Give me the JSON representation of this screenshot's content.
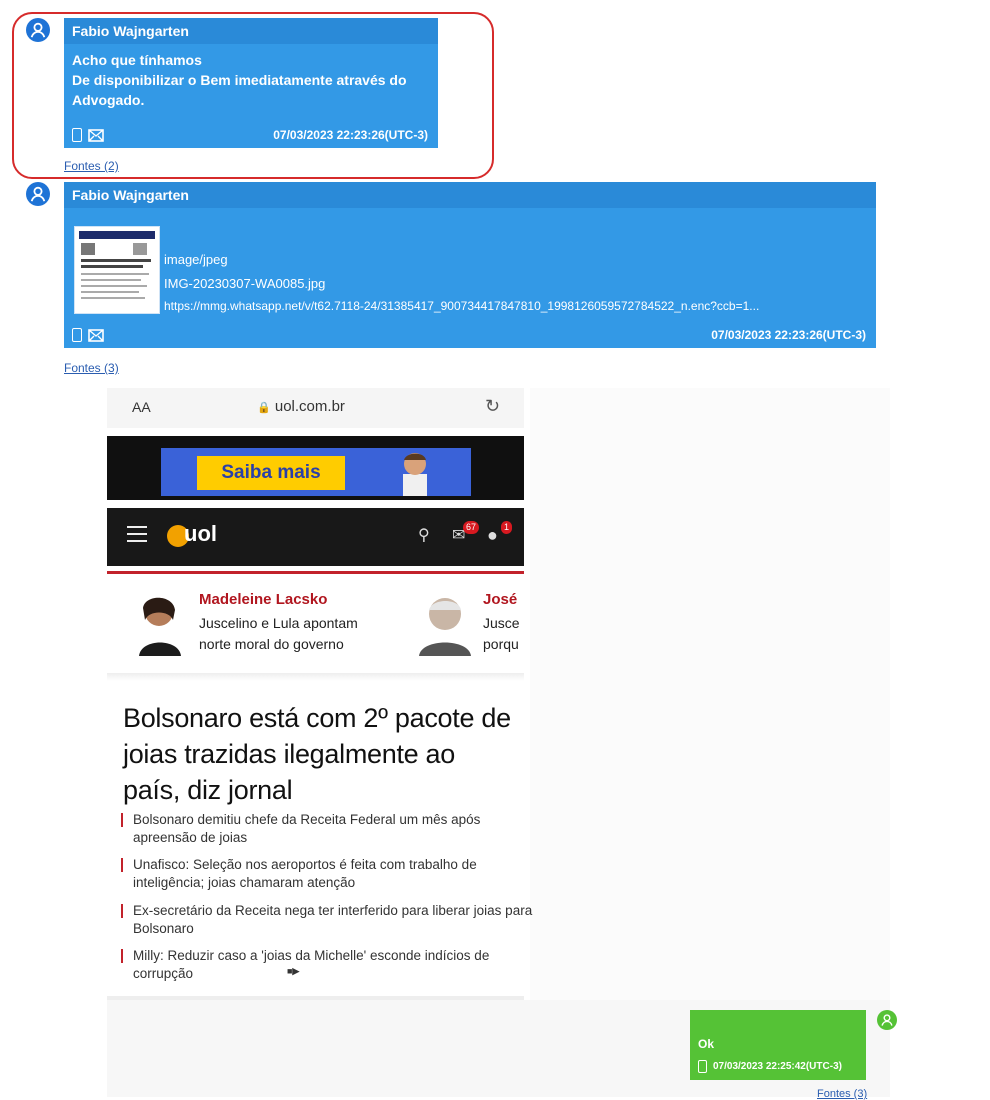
{
  "messages": [
    {
      "sender": "Fabio  Wajngarten",
      "lines": [
        "Acho que tínhamos",
        "De disponibilizar o Bem imediatamente através do",
        "Advogado."
      ],
      "timestamp": "07/03/2023 22:23:26(UTC-3)",
      "sources_label": "Fontes (2)"
    },
    {
      "sender": "Fabio  Wajngarten",
      "attachment": {
        "mime": "image/jpeg",
        "filename": "IMG-20230307-WA0085.jpg",
        "url": "https://mmg.whatsapp.net/v/t62.7118-24/31385417_900734417847810_1998126059572784522_n.enc?ccb=1..."
      },
      "timestamp": "07/03/2023 22:23:26(UTC-3)",
      "sources_label": "Fontes (3)"
    },
    {
      "sender": "",
      "lines": [
        "Ok"
      ],
      "timestamp": "07/03/2023 22:25:42(UTC-3)",
      "sources_label": "Fontes (3)"
    }
  ],
  "screenshot": {
    "address_bar": {
      "text_size": "AA",
      "domain": "uol.com.br"
    },
    "ad": {
      "button": "Saiba mais"
    },
    "nav": {
      "logo": "uol",
      "mail_badge": "67",
      "user_badge": "1"
    },
    "columnists": [
      {
        "name": "Madeleine Lacsko",
        "text": "Juscelino e Lula apontam norte moral do governo"
      },
      {
        "name": "José",
        "text": "Jusce porqu"
      }
    ],
    "headline": "Bolsonaro está com 2º pacote de joias trazidas ilegalmente ao país, diz jornal",
    "related": [
      "Bolsonaro demitiu chefe da Receita Federal um mês após apreensão de joias",
      "Unafisco: Seleção nos aeroportos é feita com trabalho de inteligência; joias chamaram atenção",
      "Ex-secretário da Receita nega ter interferido para liberar joias para Bolsonaro",
      "Milly: Reduzir caso a 'joias da Michelle' esconde indícios de corrupção"
    ]
  },
  "colors": {
    "incoming": "#3399e6",
    "outgoing": "#55c236",
    "highlight": "#d62b2b",
    "uol_red": "#c2222b"
  }
}
